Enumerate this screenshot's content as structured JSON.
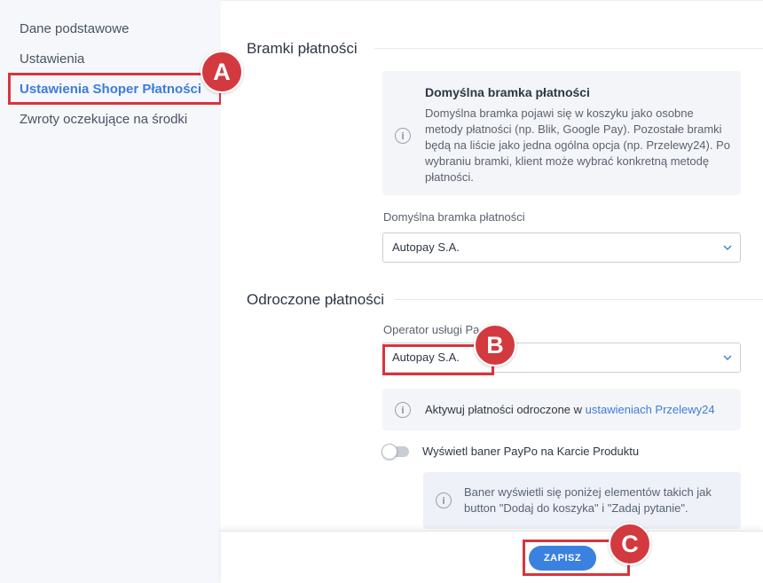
{
  "sidebar": {
    "items": [
      {
        "label": "Dane podstawowe"
      },
      {
        "label": "Ustawienia"
      },
      {
        "label": "Ustawienia Shoper Płatności"
      },
      {
        "label": "Zwroty oczekujące na środki"
      }
    ]
  },
  "markers": {
    "a": "A",
    "b": "B",
    "c": "C"
  },
  "gateways": {
    "title": "Bramki płatności",
    "info_title": "Domyślna bramka płatności",
    "info_lines": [
      "Domyślna bramka pojawi się w koszyku jako osobne",
      "metody płatności (np. Blik, Google Pay). Pozostałe bramki",
      "będą na liście jako jedna ogólna opcja (np. Przelewy24). Po",
      "wybraniu bramki, klient może wybrać konkretną metodę",
      "płatności."
    ],
    "select_label": "Domyślna bramka płatności",
    "select_value": "Autopay S.A."
  },
  "deferred": {
    "title": "Odroczone płatności",
    "operator_label": "Operator usługi Pa",
    "operator_value": "Autopay S.A.",
    "activate_text": "Aktywuj płatności odroczone w ",
    "activate_link": "ustawieniach Przelewy24",
    "toggle_label": "Wyświetl baner PayPo na Karcie Produktu",
    "toggle_on": false,
    "banner_lines": [
      "Baner wyświetli się poniżej elementów takich jak",
      "button \"Dodaj do koszyka\" i \"Zadaj pytanie\"."
    ]
  },
  "footer": {
    "save_label": "ZAPISZ"
  },
  "colors": {
    "accent": "#3b82e0",
    "marker": "#d23a3f",
    "sidebar_bg": "#f6f7fa"
  }
}
